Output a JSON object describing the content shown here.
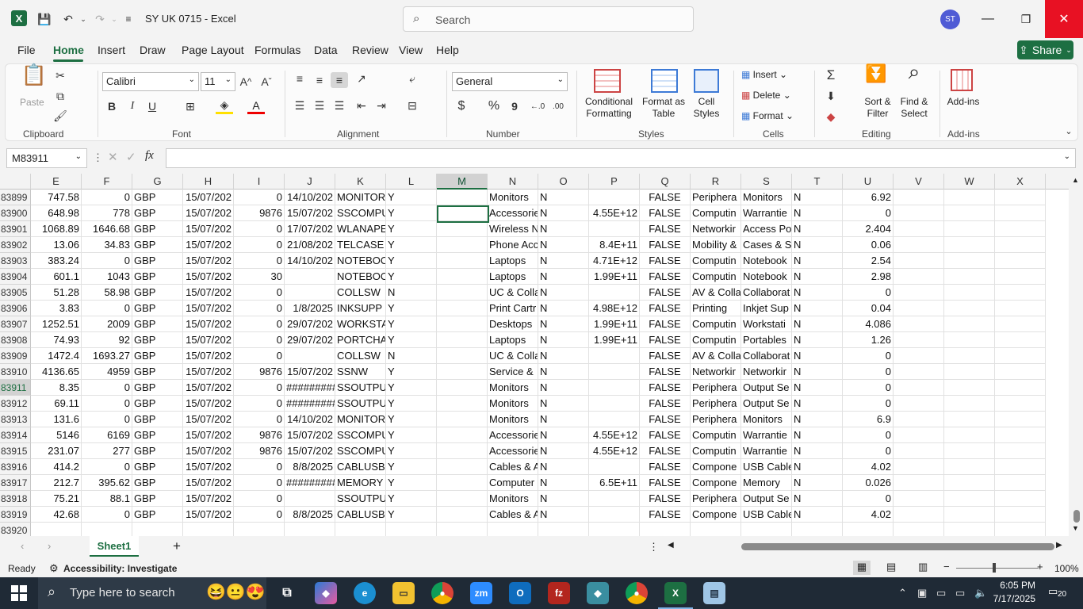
{
  "window": {
    "title": "SY UK 0715  -  Excel",
    "search_placeholder": "Search",
    "user_initials": "ST",
    "minimize": "—",
    "restore": "❐",
    "close": "✕"
  },
  "menu": {
    "tabs": [
      "File",
      "Home",
      "Insert",
      "Draw",
      "Page Layout",
      "Formulas",
      "Data",
      "Review",
      "View",
      "Help"
    ],
    "active": "Home",
    "share_label": "Share"
  },
  "ribbon": {
    "clipboard": {
      "paste": "Paste",
      "group": "Clipboard"
    },
    "font": {
      "name": "Calibri",
      "size": "11",
      "group": "Font",
      "bold": "B",
      "italic": "I",
      "underline": "U"
    },
    "alignment": {
      "group": "Alignment"
    },
    "number": {
      "format": "General",
      "group": "Number",
      "currency": "$",
      "percent": "%",
      "comma": "9"
    },
    "styles": {
      "conditional_1": "Conditional",
      "conditional_2": "Formatting",
      "format_table_1": "Format as",
      "format_table_2": "Table",
      "cell_styles_1": "Cell",
      "cell_styles_2": "Styles",
      "group": "Styles"
    },
    "cells": {
      "insert": "Insert",
      "delete": "Delete",
      "format": "Format",
      "group": "Cells"
    },
    "editing": {
      "sort_1": "Sort &",
      "sort_2": "Filter",
      "find_1": "Find &",
      "find_2": "Select",
      "group": "Editing"
    },
    "addins": {
      "label": "Add-ins",
      "group": "Add-ins"
    }
  },
  "formula_bar": {
    "name_box": "M83911",
    "fx": "fx",
    "content": ""
  },
  "columns": [
    "E",
    "F",
    "G",
    "H",
    "I",
    "J",
    "K",
    "L",
    "M",
    "N",
    "O",
    "P",
    "Q",
    "R",
    "S",
    "T",
    "U",
    "V",
    "W",
    "X"
  ],
  "selected_column": "M",
  "selected_row": "83911",
  "rows": [
    {
      "num": "83899",
      "E": "747.58",
      "F": "0",
      "G": "GBP",
      "H": "15/07/202",
      "I": "0",
      "J": "14/10/202",
      "K": "MONITOR",
      "L": "Y",
      "N": "Monitors",
      "O": "N",
      "P": "",
      "Q": "FALSE",
      "R": "Periphera",
      "S": "Monitors",
      "T": "N",
      "U": "6.92"
    },
    {
      "num": "83900",
      "E": "648.98",
      "F": "778",
      "G": "GBP",
      "H": "15/07/202",
      "I": "9876",
      "J": "15/07/202",
      "K": "SSCOMPU",
      "L": "Y",
      "N": "Accessorie",
      "O": "N",
      "P": "4.55E+12",
      "Q": "FALSE",
      "R": "Computin",
      "S": "Warrantie",
      "T": "N",
      "U": "0"
    },
    {
      "num": "83901",
      "E": "1068.89",
      "F": "1646.68",
      "G": "GBP",
      "H": "15/07/202",
      "I": "0",
      "J": "17/07/202",
      "K": "WLANAPE",
      "L": "Y",
      "N": "Wireless N",
      "O": "N",
      "P": "",
      "Q": "FALSE",
      "R": "Networkir",
      "S": "Access Po",
      "T": "N",
      "U": "2.404"
    },
    {
      "num": "83902",
      "E": "13.06",
      "F": "34.83",
      "G": "GBP",
      "H": "15/07/202",
      "I": "0",
      "J": "21/08/202",
      "K": "TELCASE",
      "L": "Y",
      "N": "Phone Acc",
      "O": "N",
      "P": "8.4E+11",
      "Q": "FALSE",
      "R": "Mobility &",
      "S": "Cases & Sl",
      "T": "N",
      "U": "0.06"
    },
    {
      "num": "83903",
      "E": "383.24",
      "F": "0",
      "G": "GBP",
      "H": "15/07/202",
      "I": "0",
      "J": "14/10/202",
      "K": "NOTEBOO",
      "L": "Y",
      "N": "Laptops",
      "O": "N",
      "P": "4.71E+12",
      "Q": "FALSE",
      "R": "Computin",
      "S": "Notebook",
      "T": "N",
      "U": "2.54"
    },
    {
      "num": "83904",
      "E": "601.1",
      "F": "1043",
      "G": "GBP",
      "H": "15/07/202",
      "I": "30",
      "J": "",
      "K": "NOTEBOO",
      "L": "Y",
      "N": "Laptops",
      "O": "N",
      "P": "1.99E+11",
      "Q": "FALSE",
      "R": "Computin",
      "S": "Notebook",
      "T": "N",
      "U": "2.98"
    },
    {
      "num": "83905",
      "E": "51.28",
      "F": "58.98",
      "G": "GBP",
      "H": "15/07/202",
      "I": "0",
      "J": "",
      "K": "COLLSW",
      "L": "N",
      "N": "UC & Colla",
      "O": "N",
      "P": "",
      "Q": "FALSE",
      "R": "AV & Colla",
      "S": "Collaborat",
      "T": "N",
      "U": "0"
    },
    {
      "num": "83906",
      "E": "3.83",
      "F": "0",
      "G": "GBP",
      "H": "15/07/202",
      "I": "0",
      "J": "1/8/2025",
      "K": "INKSUPP",
      "L": "Y",
      "N": "Print Cartr",
      "O": "N",
      "P": "4.98E+12",
      "Q": "FALSE",
      "R": "Printing",
      "S": "Inkjet Sup",
      "T": "N",
      "U": "0.04"
    },
    {
      "num": "83907",
      "E": "1252.51",
      "F": "2009",
      "G": "GBP",
      "H": "15/07/202",
      "I": "0",
      "J": "29/07/202",
      "K": "WORKSTA",
      "L": "Y",
      "N": "Desktops",
      "O": "N",
      "P": "1.99E+11",
      "Q": "FALSE",
      "R": "Computin",
      "S": "Workstati",
      "T": "N",
      "U": "4.086"
    },
    {
      "num": "83908",
      "E": "74.93",
      "F": "92",
      "G": "GBP",
      "H": "15/07/202",
      "I": "0",
      "J": "29/07/202",
      "K": "PORTCHAI",
      "L": "Y",
      "N": "Laptops",
      "O": "N",
      "P": "1.99E+11",
      "Q": "FALSE",
      "R": "Computin",
      "S": "Portables",
      "T": "N",
      "U": "1.26"
    },
    {
      "num": "83909",
      "E": "1472.4",
      "F": "1693.27",
      "G": "GBP",
      "H": "15/07/202",
      "I": "0",
      "J": "",
      "K": "COLLSW",
      "L": "N",
      "N": "UC & Colla",
      "O": "N",
      "P": "",
      "Q": "FALSE",
      "R": "AV & Colla",
      "S": "Collaborat",
      "T": "N",
      "U": "0"
    },
    {
      "num": "83910",
      "E": "4136.65",
      "F": "4959",
      "G": "GBP",
      "H": "15/07/202",
      "I": "9876",
      "J": "15/07/202",
      "K": "SSNW",
      "L": "Y",
      "N": "Service &",
      "O": "N",
      "P": "",
      "Q": "FALSE",
      "R": "Networkir",
      "S": "Networkir",
      "T": "N",
      "U": "0"
    },
    {
      "num": "83911",
      "E": "8.35",
      "F": "0",
      "G": "GBP",
      "H": "15/07/202",
      "I": "0",
      "J": "#########",
      "K": "SSOUTPUT",
      "L": "Y",
      "N": "Monitors",
      "O": "N",
      "P": "",
      "Q": "FALSE",
      "R": "Periphera",
      "S": "Output Se",
      "T": "N",
      "U": "0"
    },
    {
      "num": "83912",
      "E": "69.11",
      "F": "0",
      "G": "GBP",
      "H": "15/07/202",
      "I": "0",
      "J": "#########",
      "K": "SSOUTPUT",
      "L": "Y",
      "N": "Monitors",
      "O": "N",
      "P": "",
      "Q": "FALSE",
      "R": "Periphera",
      "S": "Output Se",
      "T": "N",
      "U": "0"
    },
    {
      "num": "83913",
      "E": "131.6",
      "F": "0",
      "G": "GBP",
      "H": "15/07/202",
      "I": "0",
      "J": "14/10/202",
      "K": "MONITOR",
      "L": "Y",
      "N": "Monitors",
      "O": "N",
      "P": "",
      "Q": "FALSE",
      "R": "Periphera",
      "S": "Monitors",
      "T": "N",
      "U": "6.9"
    },
    {
      "num": "83914",
      "E": "5146",
      "F": "6169",
      "G": "GBP",
      "H": "15/07/202",
      "I": "9876",
      "J": "15/07/202",
      "K": "SSCOMPU",
      "L": "Y",
      "N": "Accessorie",
      "O": "N",
      "P": "4.55E+12",
      "Q": "FALSE",
      "R": "Computin",
      "S": "Warrantie",
      "T": "N",
      "U": "0"
    },
    {
      "num": "83915",
      "E": "231.07",
      "F": "277",
      "G": "GBP",
      "H": "15/07/202",
      "I": "9876",
      "J": "15/07/202",
      "K": "SSCOMPU",
      "L": "Y",
      "N": "Accessorie",
      "O": "N",
      "P": "4.55E+12",
      "Q": "FALSE",
      "R": "Computin",
      "S": "Warrantie",
      "T": "N",
      "U": "0"
    },
    {
      "num": "83916",
      "E": "414.2",
      "F": "0",
      "G": "GBP",
      "H": "15/07/202",
      "I": "0",
      "J": "8/8/2025",
      "K": "CABLUSB",
      "L": "Y",
      "N": "Cables & A",
      "O": "N",
      "P": "",
      "Q": "FALSE",
      "R": "Compone",
      "S": "USB Cable",
      "T": "N",
      "U": "4.02"
    },
    {
      "num": "83917",
      "E": "212.7",
      "F": "395.62",
      "G": "GBP",
      "H": "15/07/202",
      "I": "0",
      "J": "#########",
      "K": "MEMORY",
      "L": "Y",
      "N": "Computer",
      "O": "N",
      "P": "6.5E+11",
      "Q": "FALSE",
      "R": "Compone",
      "S": "Memory",
      "T": "N",
      "U": "0.026"
    },
    {
      "num": "83918",
      "E": "75.21",
      "F": "88.1",
      "G": "GBP",
      "H": "15/07/202",
      "I": "0",
      "J": "",
      "K": "SSOUTPUT",
      "L": "Y",
      "N": "Monitors",
      "O": "N",
      "P": "",
      "Q": "FALSE",
      "R": "Periphera",
      "S": "Output Se",
      "T": "N",
      "U": "0"
    },
    {
      "num": "83919",
      "E": "42.68",
      "F": "0",
      "G": "GBP",
      "H": "15/07/202",
      "I": "0",
      "J": "8/8/2025",
      "K": "CABLUSB",
      "L": "Y",
      "N": "Cables & A",
      "O": "N",
      "P": "",
      "Q": "FALSE",
      "R": "Compone",
      "S": "USB Cable",
      "T": "N",
      "U": "4.02"
    },
    {
      "num": "83920",
      "E": "",
      "F": "",
      "G": "",
      "H": "",
      "I": "",
      "J": "",
      "K": "",
      "L": "",
      "N": "",
      "O": "",
      "P": "",
      "Q": "",
      "R": "",
      "S": "",
      "T": "",
      "U": ""
    }
  ],
  "sheets": {
    "active": "Sheet1",
    "add": "+"
  },
  "status": {
    "ready": "Ready",
    "accessibility": "Accessibility: Investigate",
    "zoom": "100%"
  },
  "taskbar": {
    "search_placeholder": "Type here to search",
    "time": "6:05 PM",
    "date": "7/17/2025",
    "notifications": "20"
  },
  "colors": {
    "excel_green": "#1d6f42",
    "close_red": "#e81123",
    "taskbar": "#1f2a36"
  }
}
